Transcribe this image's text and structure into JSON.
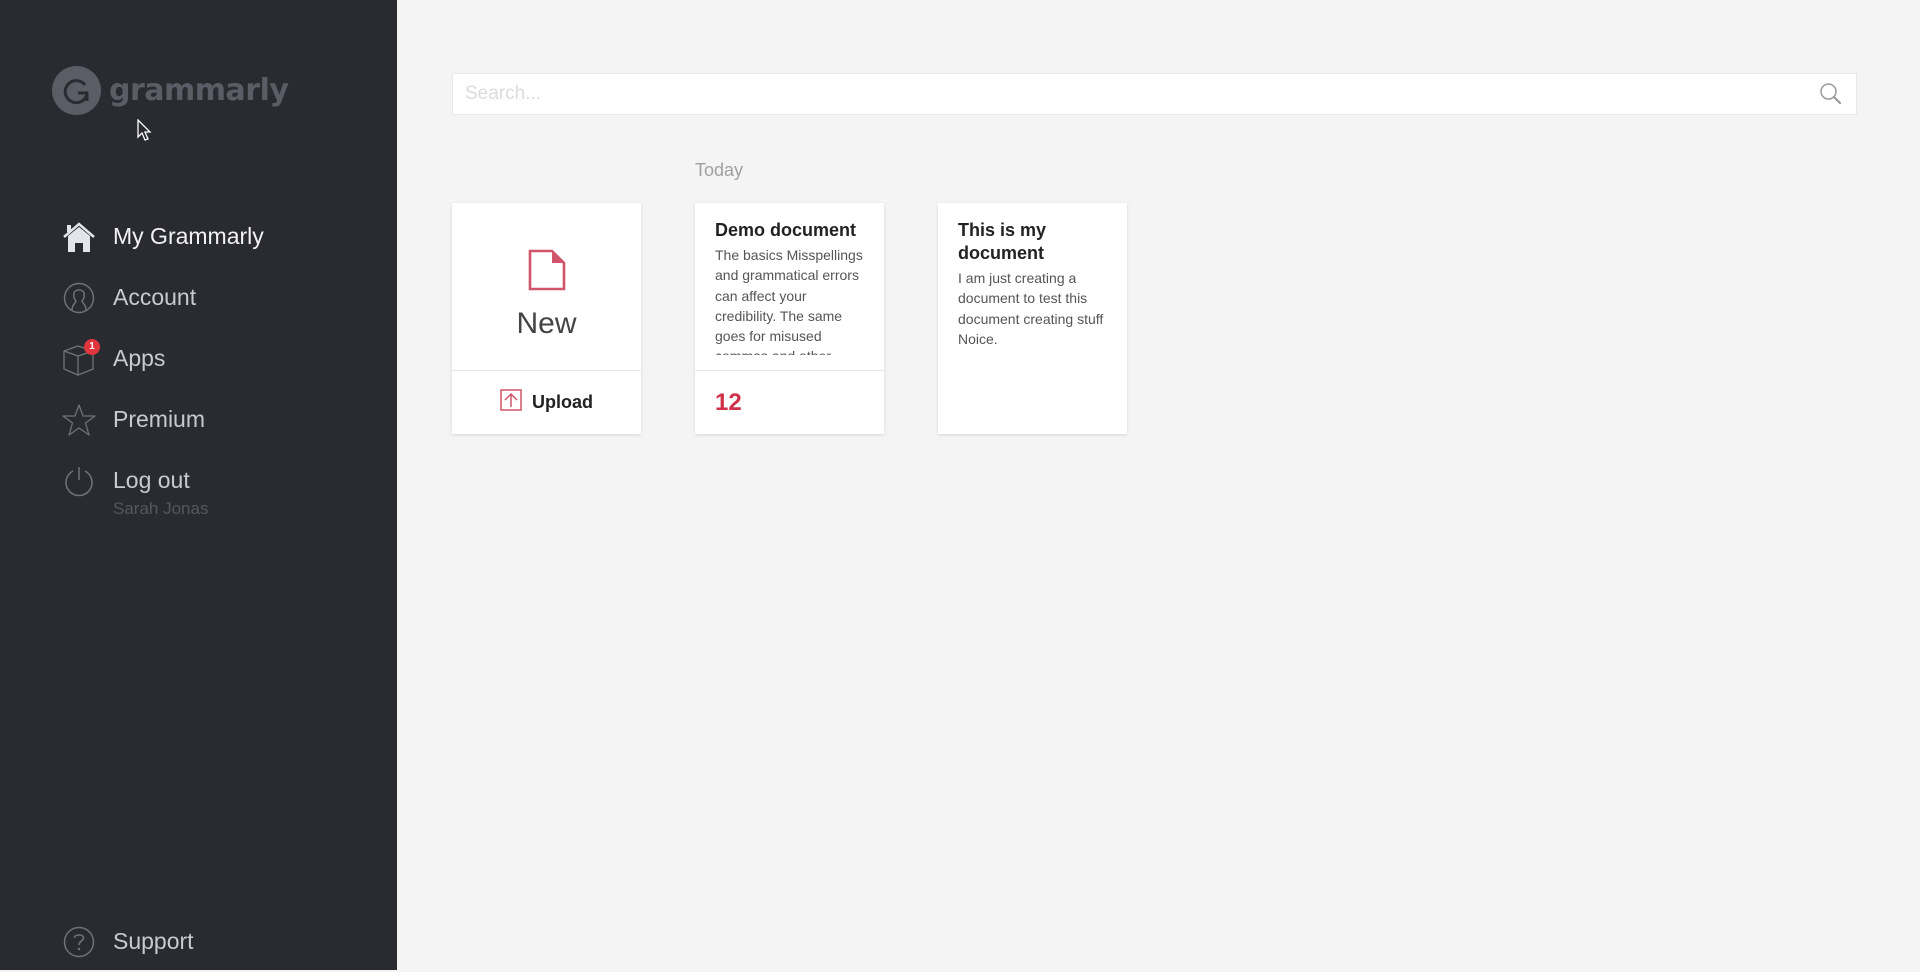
{
  "app": {
    "brand": "grammarly"
  },
  "sidebar": {
    "items": [
      {
        "label": "My Grammarly",
        "icon": "home-icon",
        "active": true
      },
      {
        "label": "Account",
        "icon": "user-icon"
      },
      {
        "label": "Apps",
        "icon": "box-icon",
        "badge": "1"
      },
      {
        "label": "Premium",
        "icon": "star-icon"
      },
      {
        "label": "Log out",
        "icon": "power-icon",
        "sub": "Sarah Jonas"
      }
    ],
    "support": {
      "label": "Support",
      "icon": "help-icon"
    }
  },
  "search": {
    "placeholder": "Search...",
    "value": ""
  },
  "documents": {
    "section_label": "Today",
    "new_card": {
      "label": "New",
      "upload_label": "Upload"
    },
    "items": [
      {
        "title": "Demo document",
        "excerpt": "The basics Misspellings and grammatical errors can affect your credibility. The same goes for misused commas and other",
        "score": "12"
      },
      {
        "title": "This is my document",
        "excerpt": "I am just creating a document to test this document creating stuff Noice."
      }
    ]
  },
  "colors": {
    "sidebar_bg": "#2a2b31",
    "accent": "#d0314a",
    "badge": "#e0353e"
  }
}
